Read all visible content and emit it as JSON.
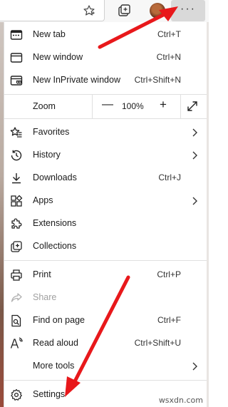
{
  "toolbar": {
    "favorite_star_icon": "star-outline",
    "collections_icon": "collections",
    "more_button_label": "···"
  },
  "menu": {
    "items": [
      {
        "label": "New tab",
        "shortcut": "Ctrl+T"
      },
      {
        "label": "New window",
        "shortcut": "Ctrl+N"
      },
      {
        "label": "New InPrivate window",
        "shortcut": "Ctrl+Shift+N"
      },
      {
        "label": "Favorites",
        "shortcut": ""
      },
      {
        "label": "History",
        "shortcut": ""
      },
      {
        "label": "Downloads",
        "shortcut": "Ctrl+J"
      },
      {
        "label": "Apps",
        "shortcut": ""
      },
      {
        "label": "Extensions",
        "shortcut": ""
      },
      {
        "label": "Collections",
        "shortcut": ""
      },
      {
        "label": "Print",
        "shortcut": "Ctrl+P"
      },
      {
        "label": "Share",
        "shortcut": ""
      },
      {
        "label": "Find on page",
        "shortcut": "Ctrl+F"
      },
      {
        "label": "Read aloud",
        "shortcut": "Ctrl+Shift+U"
      },
      {
        "label": "More tools",
        "shortcut": ""
      },
      {
        "label": "Settings",
        "shortcut": ""
      }
    ],
    "zoom": {
      "label": "Zoom",
      "minus": "—",
      "value": "100%",
      "plus": "+"
    }
  },
  "watermark": "wsxdn.com",
  "colors": {
    "arrow": "#e8181b",
    "more_button_bg": "#d9d9d9",
    "divider": "#e0e0e0"
  }
}
